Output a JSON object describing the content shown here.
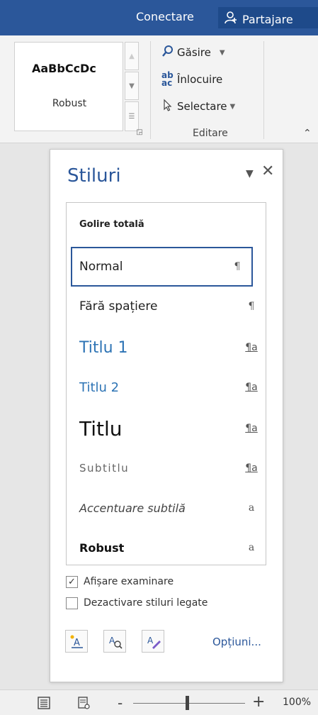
{
  "titlebar": {
    "connect_label": "Conectare",
    "share_label": "Partajare"
  },
  "ribbon": {
    "style_preview": "AaBbCcDc",
    "style_name": "Robust",
    "edit": {
      "find_label": "Găsire",
      "replace_label": "Înlocuire",
      "select_label": "Selectare",
      "group_label": "Editare"
    }
  },
  "styles_pane": {
    "title": "Stiluri",
    "items": [
      {
        "label": "Golire totală",
        "mark": ""
      },
      {
        "label": "Normal",
        "mark": "¶",
        "selected": true
      },
      {
        "label": "Fără spațiere",
        "mark": "¶"
      },
      {
        "label": "Titlu 1",
        "mark": "¶a"
      },
      {
        "label": "Titlu 2",
        "mark": "¶a"
      },
      {
        "label": "Titlu",
        "mark": "¶a"
      },
      {
        "label": "Subtitlu",
        "mark": "¶a"
      },
      {
        "label": "Accentuare subtilă",
        "mark": "a"
      },
      {
        "label": "Robust",
        "mark": "a"
      }
    ],
    "show_preview_label": "Afișare examinare",
    "show_preview_checked": true,
    "disable_linked_label": "Dezactivare stiluri legate",
    "disable_linked_checked": false,
    "options_label": "Opțiuni..."
  },
  "statusbar": {
    "zoom_level": "100%",
    "zoom_minus": "-",
    "zoom_plus": "+"
  },
  "colors": {
    "brand": "#2b579a",
    "heading": "#2e74b5"
  },
  "icons": [
    "person-add-icon",
    "search-icon",
    "replace-icon",
    "cursor-select-icon",
    "dropdown-arrow-icon",
    "close-icon",
    "check-icon",
    "new-style-icon",
    "style-inspector-icon",
    "manage-styles-icon",
    "print-layout-icon",
    "read-mode-icon",
    "chevron-up-icon",
    "dialog-launcher-icon"
  ]
}
